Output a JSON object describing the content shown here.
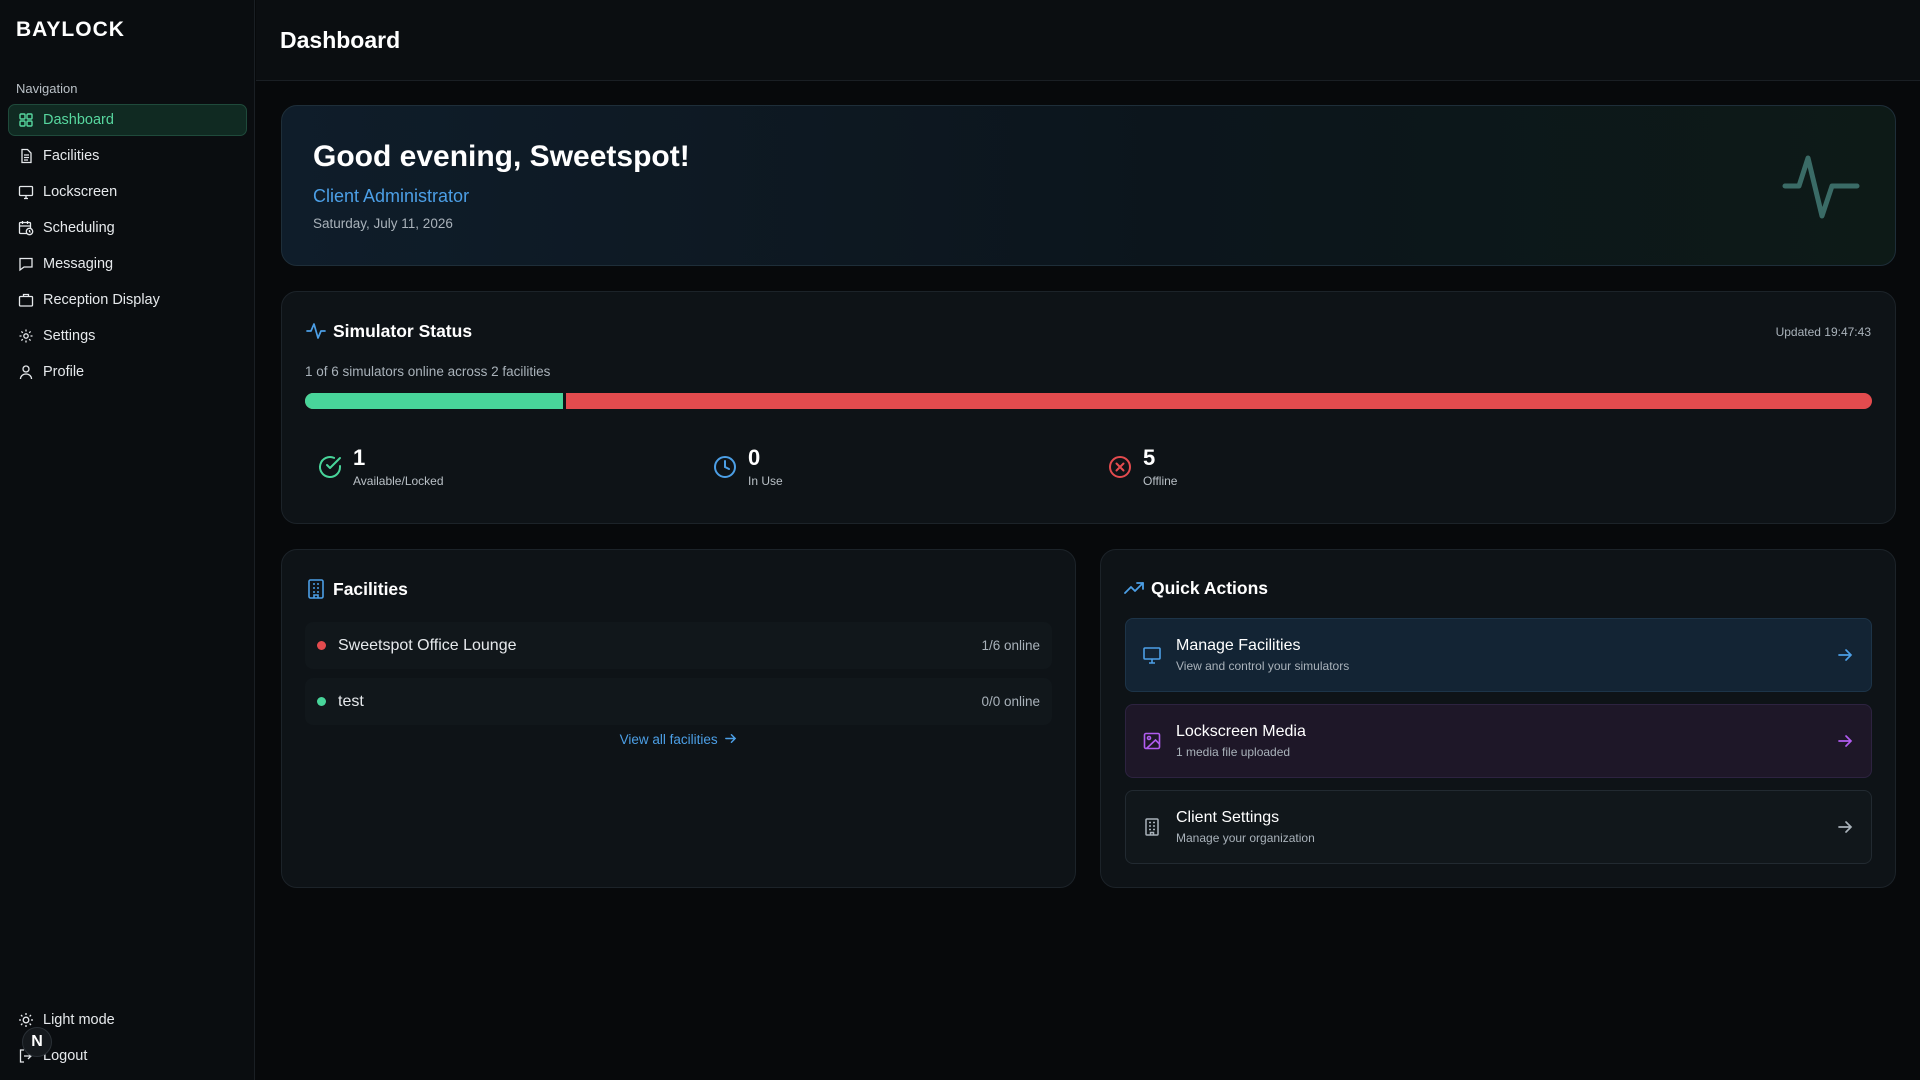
{
  "app": {
    "brand": "BAYLOCK"
  },
  "sidebar": {
    "heading": "Navigation",
    "items": [
      {
        "label": "Dashboard",
        "icon": "dashboard-icon",
        "active": true
      },
      {
        "label": "Facilities",
        "icon": "document-icon"
      },
      {
        "label": "Lockscreen",
        "icon": "monitor-icon"
      },
      {
        "label": "Scheduling",
        "icon": "calendar-clock-icon"
      },
      {
        "label": "Messaging",
        "icon": "message-icon"
      },
      {
        "label": "Reception Display",
        "icon": "briefcase-icon"
      },
      {
        "label": "Settings",
        "icon": "gear-icon"
      },
      {
        "label": "Profile",
        "icon": "user-icon"
      }
    ],
    "bottom": {
      "light_mode": "Light mode",
      "logout": "Logout",
      "avatar_letter": "N"
    }
  },
  "header": {
    "title": "Dashboard"
  },
  "welcome": {
    "greeting": "Good evening, Sweetspot!",
    "role": "Client Administrator",
    "date": "Saturday, July 11, 2026"
  },
  "status": {
    "title": "Simulator Status",
    "updated": "Updated 19:47:43",
    "summary": "1 of 6 simulators online across 2 facilities",
    "online_fraction": 0.1667,
    "stats": [
      {
        "value": "1",
        "label": "Available/Locked",
        "color": "#48d59a"
      },
      {
        "value": "0",
        "label": "In Use",
        "color": "#4c9fe6"
      },
      {
        "value": "5",
        "label": "Offline",
        "color": "#e34b4e"
      }
    ]
  },
  "facilities": {
    "title": "Facilities",
    "items": [
      {
        "name": "Sweetspot Office Lounge",
        "count": "1/6 online",
        "status_color": "#e34b4e"
      },
      {
        "name": "test",
        "count": "0/0 online",
        "status_color": "#48d59a"
      }
    ],
    "view_all": "View all facilities"
  },
  "quick_actions": {
    "title": "Quick Actions",
    "items": [
      {
        "title": "Manage Facilities",
        "subtitle": "View and control your simulators",
        "accent": "#4c9fe6"
      },
      {
        "title": "Lockscreen Media",
        "subtitle": "1 media file uploaded",
        "accent": "#b15cf0"
      },
      {
        "title": "Client Settings",
        "subtitle": "Manage your organization",
        "accent": "#a9b2ba"
      }
    ]
  },
  "colors": {
    "accent_green": "#48d59a",
    "accent_blue": "#4c9fe6",
    "accent_red": "#e34b4e",
    "accent_purple": "#b15cf0"
  }
}
